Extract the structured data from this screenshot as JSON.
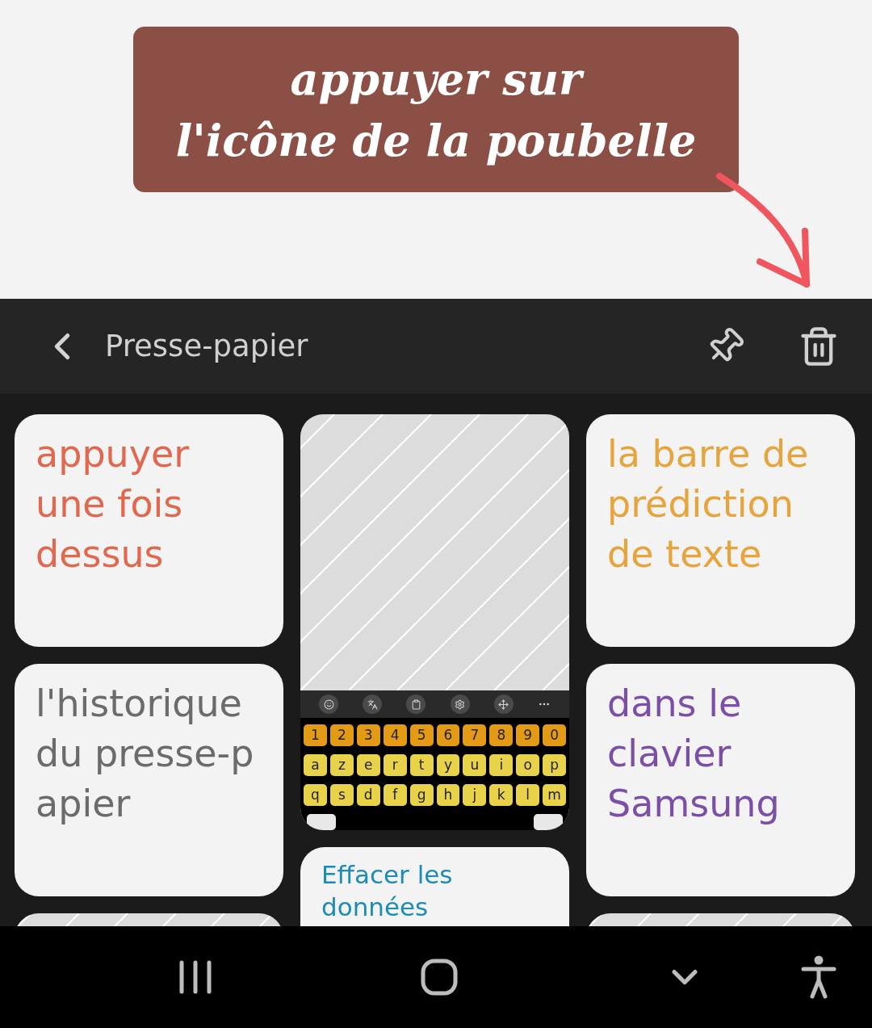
{
  "callout": {
    "lines": [
      "appuyer sur",
      "l'icône de la poubelle"
    ]
  },
  "header": {
    "title": "Presse-papier"
  },
  "columns": [
    {
      "cards": [
        {
          "kind": "text",
          "lines": [
            "appuyer",
            "une fois",
            "dessus"
          ],
          "color": "#e0684e"
        },
        {
          "kind": "text",
          "lines": [
            "l'historique",
            "du presse-p",
            "apier"
          ],
          "color": "#6b6b6b"
        },
        {
          "kind": "image"
        }
      ]
    },
    {
      "cards": [
        {
          "kind": "keyboard"
        },
        {
          "kind": "note",
          "text": "Effacer les données",
          "color": "#1a8cb5"
        }
      ]
    },
    {
      "cards": [
        {
          "kind": "text",
          "lines": [
            "la barre de",
            "prédiction",
            "de texte"
          ],
          "color": "#e8a43c"
        },
        {
          "kind": "text",
          "lines": [
            "dans le",
            "clavier",
            "Samsung"
          ],
          "color": "#7b4fa8"
        },
        {
          "kind": "image"
        }
      ]
    }
  ],
  "keyboard": {
    "rows": [
      {
        "color": "#e39a14",
        "keys": [
          "1",
          "2",
          "3",
          "4",
          "5",
          "6",
          "7",
          "8",
          "9",
          "0"
        ]
      },
      {
        "color": "#e8d24a",
        "keys": [
          "a",
          "z",
          "e",
          "r",
          "t",
          "y",
          "u",
          "i",
          "o",
          "p"
        ]
      },
      {
        "color": "#e8d24a",
        "keys": [
          "q",
          "s",
          "d",
          "f",
          "g",
          "h",
          "j",
          "k",
          "l",
          "m"
        ]
      }
    ]
  }
}
